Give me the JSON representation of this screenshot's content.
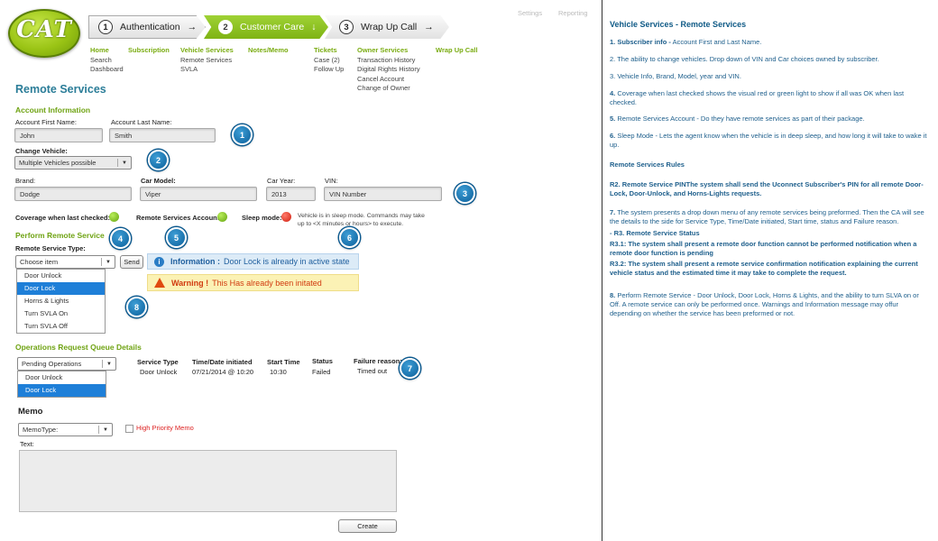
{
  "logo": {
    "text": "CAT"
  },
  "top_links": [
    "Settings",
    "Reporting"
  ],
  "steps": [
    {
      "num": "1",
      "label": "Authentication",
      "arrow": "→"
    },
    {
      "num": "2",
      "label": "Customer Care",
      "arrow": "↓"
    },
    {
      "num": "3",
      "label": "Wrap Up Call",
      "arrow": "→"
    }
  ],
  "nav": {
    "home": {
      "title": "Home",
      "items": [
        "Search",
        "Dashboard"
      ]
    },
    "subscription": {
      "title": "Subscription"
    },
    "vehicle": {
      "title": "Vehicle Services",
      "items": [
        "Remote Services",
        "SVLA"
      ]
    },
    "notes": {
      "title": "Notes/Memo"
    },
    "tickets": {
      "title": "Tickets",
      "items": [
        "Case (2)",
        "Follow Up"
      ]
    },
    "owner": {
      "title": "Owner Services",
      "items": [
        "Transaction History",
        "Digital Rights History",
        "Cancel Account",
        "Change of Owner"
      ]
    },
    "wrap": {
      "title": "Wrap Up Call"
    }
  },
  "page_title": "Remote Services",
  "account": {
    "section": "Account Information",
    "first_label": "Account First Name:",
    "first_value": "John",
    "last_label": "Account Last Name:",
    "last_value": "Smith",
    "change_label": "Change Vehicle:",
    "change_value": "Multiple Vehicles possible",
    "brand_label": "Brand:",
    "brand_value": "Dodge",
    "model_label": "Car Model:",
    "model_value": "Viper",
    "year_label": "Car Year:",
    "year_value": "2013",
    "vin_label": "VIN:",
    "vin_value": "VIN Number",
    "coverage_label": "Coverage when last checked:",
    "remote_label": "Remote Services Account:",
    "sleep_label": "Sleep mode:",
    "sleep_text": "Vehicle is in sleep mode. Commands may take up to <X minutes or hours> to execute."
  },
  "perform": {
    "section": "Perform Remote Service",
    "type_label": "Remote Service Type:",
    "select_value": "Choose item",
    "send": "Send",
    "options": [
      "Door Unlock",
      "Door Lock",
      "Horns & Lights",
      "Turn SVLA On",
      "Turn SVLA Off"
    ],
    "selected_index": 1,
    "info_icon": "i",
    "info_bold": "Information :",
    "info_text": "Door Lock is already in active state",
    "warn_icon": "!",
    "warn_bold": "Warning !",
    "warn_text": "This Has already been initated"
  },
  "queue": {
    "section": "Operations Request Queue Details",
    "select_value": "Pending Operations",
    "options": [
      "Door Unlock",
      "Door Lock"
    ],
    "selected_index": 1,
    "headers": {
      "type": "Service Type",
      "date": "Time/Date initiated",
      "start": "Start Time",
      "status": "Status",
      "fail": "Failure reason:"
    },
    "row": {
      "type": "Door Unlock",
      "date": "07/21/2014 @ 10:20",
      "start": "10:30",
      "status": "Failed",
      "fail": "Timed out"
    }
  },
  "memo": {
    "section": "Memo",
    "type_value": "MemoType:",
    "priority_label": "High Priority Memo",
    "text_label": "Text:",
    "create": "Create"
  },
  "badges": [
    "1",
    "2",
    "3",
    "4",
    "5",
    "6",
    "7",
    "8"
  ],
  "colors": {
    "accent_green": "#7fb314",
    "title_blue": "#2b7d98",
    "badge_blue": "#1670b0",
    "selected_blue": "#1e7fd8"
  },
  "right_panel": {
    "title": "Vehicle Services - Remote Services",
    "p1_bold": "1. Subscriber info -",
    "p1": "Account First and Last Name.",
    "p2": "2. The ability to change vehicles. Drop down of VIN and Car choices owned by subscriber.",
    "p3": "3. Vehicle Info, Brand, Model, year and VIN.",
    "p4_bold": "4.",
    "p4": "Coverage when last checked shows the visual red or green light to show if all was OK when last checked.",
    "p5_bold": "5.",
    "p5": "Remote Services Account - Do they have remote services as part of their package.",
    "p6_bold": "6.",
    "p6": "Sleep Mode - Lets the agent know when the vehicle is in deep sleep, and how long it will take to wake it up.",
    "rules": "Remote Services Rules",
    "r2": "R2. Remote Service PINThe system shall send the Uconnect Subscriber's PIN for all remote Door-Lock, Door-Unlock, and Horns-Lights requests.",
    "p7_bold": "7.",
    "p7": "The system presents a drop down menu of any remote services being preformed. Then the CA will see the details to the side for Service Type, Time/Date initiated, Start time, status and Failure reason.",
    "r3": "- R3. Remote Service Status",
    "r31": "R3.1: The system shall present a remote door function cannot be performed notification when a remote door function is pending",
    "r32": "R3.2: The system shall present a remote service confirmation notification explaining the current vehicle status and the estimated time it may take to complete the request.",
    "p8_bold": "8.",
    "p8": "Perform Remote Service - Door Unlock, Door Lock, Horns & Lights, and the ability to turn SLVA on or Off. A remote service can only be performed once. Warnings and Information message may offur depending on whether the service has been preformed or not."
  }
}
